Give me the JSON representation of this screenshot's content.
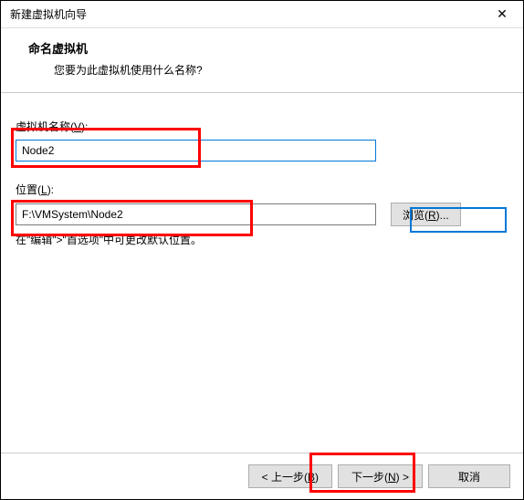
{
  "window": {
    "title": "新建虚拟机向导"
  },
  "header": {
    "title": "命名虚拟机",
    "subtitle": "您要为此虚拟机使用什么名称?"
  },
  "form": {
    "vmName": {
      "label_pre": "虚拟机名称(",
      "label_key": "V",
      "label_post": "):",
      "value": "Node2"
    },
    "location": {
      "label_pre": "位置(",
      "label_key": "L",
      "label_post": "):",
      "value": "F:\\VMSystem\\Node2",
      "browse_pre": "浏览(",
      "browse_key": "R",
      "browse_post": ")..."
    },
    "hint": "在\"编辑\">\"首选项\"中可更改默认位置。"
  },
  "footer": {
    "back_pre": "< 上一步(",
    "back_key": "B",
    "back_post": ")",
    "next_pre": "下一步(",
    "next_key": "N",
    "next_post": ") >",
    "cancel": "取消"
  }
}
